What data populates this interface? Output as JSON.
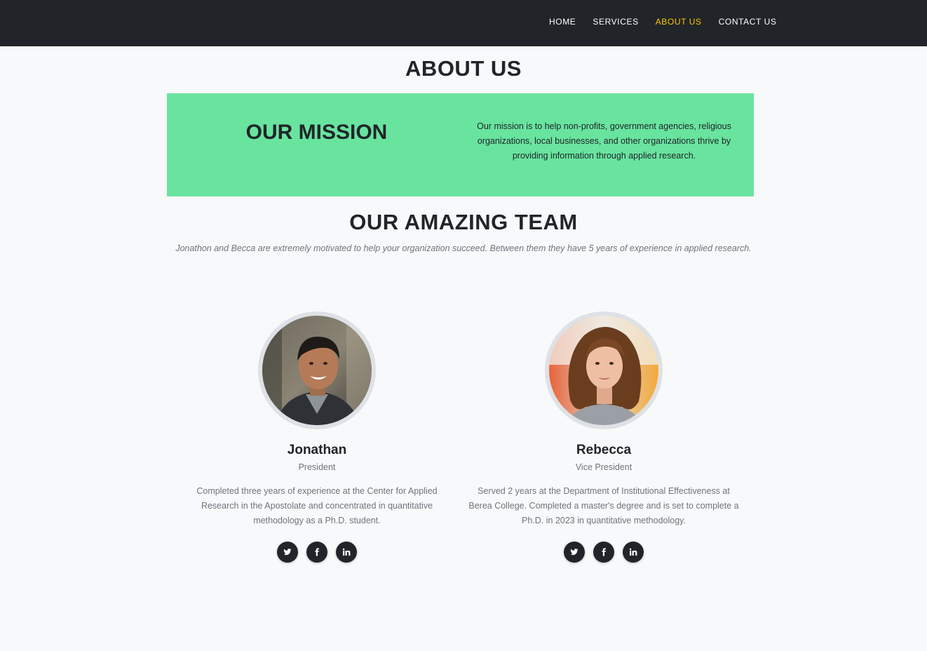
{
  "nav": {
    "items": [
      {
        "label": "HOME",
        "active": false
      },
      {
        "label": "SERVICES",
        "active": false
      },
      {
        "label": "ABOUT US",
        "active": true
      },
      {
        "label": "CONTACT US",
        "active": false
      }
    ],
    "active_color": "#fec503",
    "bg_color": "#212529"
  },
  "page": {
    "title": "ABOUT US"
  },
  "mission": {
    "title": "OUR MISSION",
    "text": "Our mission is to help non-profits, government agencies, religious organizations, local businesses, and other organizations thrive by providing information through applied research.",
    "bg_color": "#68e49f"
  },
  "team": {
    "title": "OUR AMAZING TEAM",
    "subtitle": "Jonathon and Becca are extremely motivated to help your organization succeed. Between them they have 5 years of experience in applied research.",
    "members": [
      {
        "name": "Jonathan",
        "role": "President",
        "bio": "Completed three years of experience at the Center for Applied Research in the Apostolate and concentrated in quantitative methodology as a Ph.D. student.",
        "social": [
          "twitter-icon",
          "facebook-icon",
          "linkedin-icon"
        ]
      },
      {
        "name": "Rebecca",
        "role": "Vice President",
        "bio": "Served 2 years at the Department of Institutional Effectiveness at Berea College. Completed a master's degree and is set to complete a Ph.D. in 2023 in quantitative methodology.",
        "social": [
          "twitter-icon",
          "facebook-icon",
          "linkedin-icon"
        ]
      }
    ]
  }
}
